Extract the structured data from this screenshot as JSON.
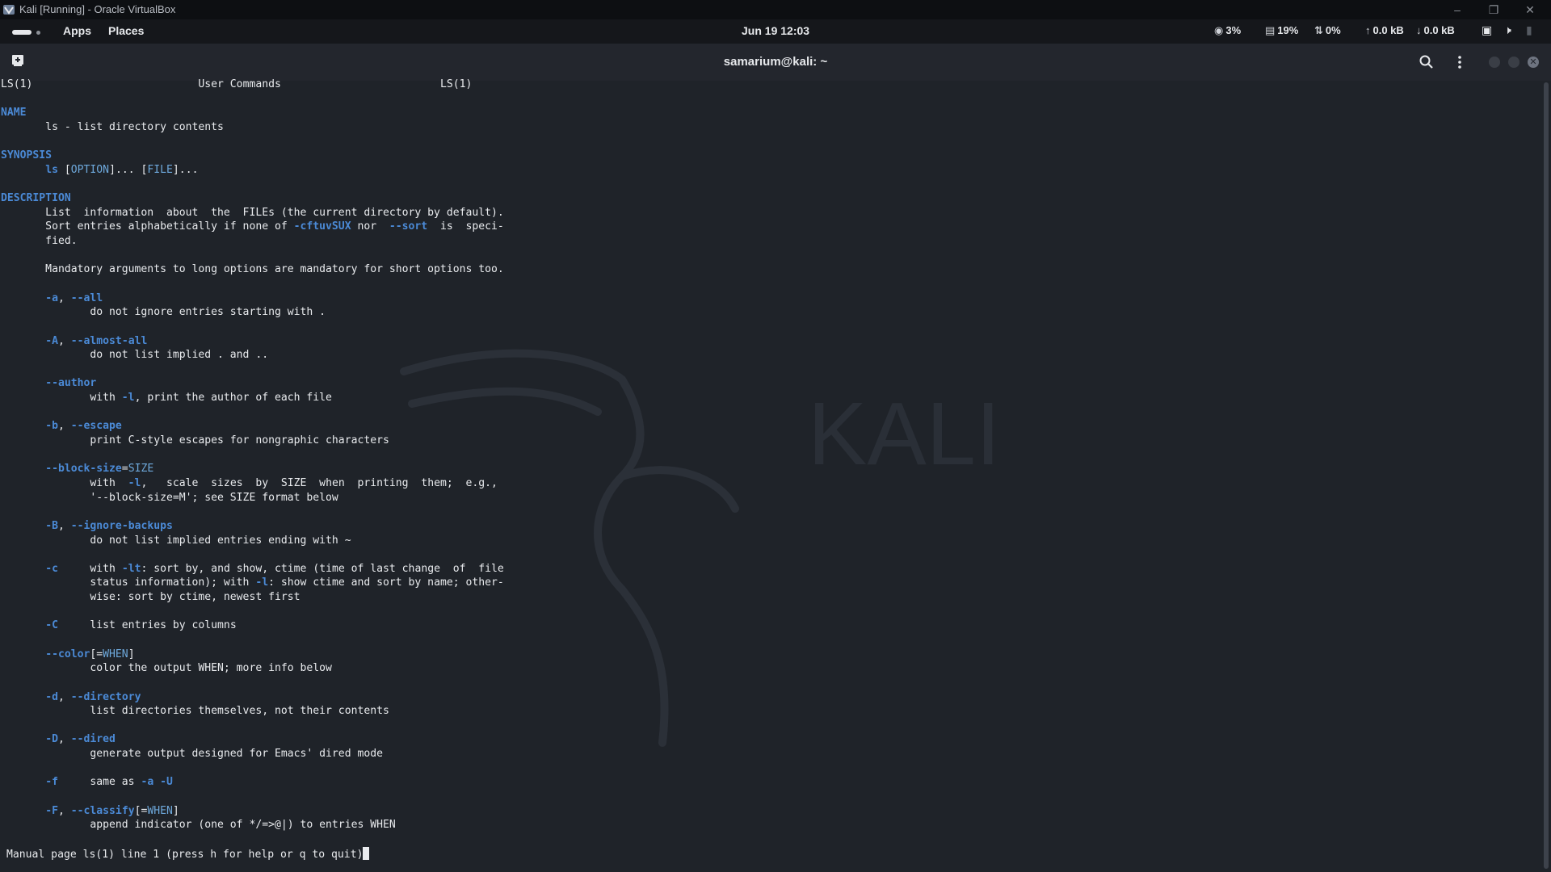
{
  "window": {
    "title": "Kali [Running] - Oracle VirtualBox",
    "icon": "virtualbox-icon",
    "controls": [
      "minimize-icon",
      "restore-icon",
      "close-icon"
    ]
  },
  "topbar": {
    "apps": "Apps",
    "places": "Places",
    "clock": "Jun 19  12:03",
    "stats": {
      "cpu": "3%",
      "mem": "19%",
      "swap": "0%",
      "net_up": "0.0 kB",
      "net_down": "0.0 kB"
    }
  },
  "terminal": {
    "title": "samarium@kali: ~",
    "watermark": "KALI",
    "status_line": "Manual page ls(1) line 1 (press h for help or q to quit)"
  },
  "man_lines": [
    [
      {
        "t": "LS(1)"
      },
      {
        "t": "                          User Commands                         "
      },
      {
        "t": "LS(1)"
      }
    ],
    [],
    [
      {
        "t": "NAME",
        "c": "b"
      }
    ],
    [
      {
        "t": "       ls - list directory contents"
      }
    ],
    [],
    [
      {
        "t": "SYNOPSIS",
        "c": "b"
      }
    ],
    [
      {
        "t": "       "
      },
      {
        "t": "ls",
        "c": "b"
      },
      {
        "t": " ["
      },
      {
        "t": "OPTION",
        "c": "u"
      },
      {
        "t": "]... ["
      },
      {
        "t": "FILE",
        "c": "u"
      },
      {
        "t": "]..."
      }
    ],
    [],
    [
      {
        "t": "DESCRIPTION",
        "c": "b"
      }
    ],
    [
      {
        "t": "       List  information  about  the  FILEs (the current directory by default)."
      }
    ],
    [
      {
        "t": "       Sort entries alphabetically if none of "
      },
      {
        "t": "-cftuvSUX",
        "c": "b"
      },
      {
        "t": " nor  "
      },
      {
        "t": "--sort",
        "c": "b"
      },
      {
        "t": "  is  speci‐"
      }
    ],
    [
      {
        "t": "       fied."
      }
    ],
    [],
    [
      {
        "t": "       Mandatory arguments to long options are mandatory for short options too."
      }
    ],
    [],
    [
      {
        "t": "       "
      },
      {
        "t": "-a",
        "c": "b"
      },
      {
        "t": ", "
      },
      {
        "t": "--all",
        "c": "b"
      }
    ],
    [
      {
        "t": "              do not ignore entries starting with ."
      }
    ],
    [],
    [
      {
        "t": "       "
      },
      {
        "t": "-A",
        "c": "b"
      },
      {
        "t": ", "
      },
      {
        "t": "--almost-all",
        "c": "b"
      }
    ],
    [
      {
        "t": "              do not list implied . and .."
      }
    ],
    [],
    [
      {
        "t": "       "
      },
      {
        "t": "--author",
        "c": "b"
      }
    ],
    [
      {
        "t": "              with "
      },
      {
        "t": "-l",
        "c": "b"
      },
      {
        "t": ", print the author of each file"
      }
    ],
    [],
    [
      {
        "t": "       "
      },
      {
        "t": "-b",
        "c": "b"
      },
      {
        "t": ", "
      },
      {
        "t": "--escape",
        "c": "b"
      }
    ],
    [
      {
        "t": "              print C-style escapes for nongraphic characters"
      }
    ],
    [],
    [
      {
        "t": "       "
      },
      {
        "t": "--block-size",
        "c": "b"
      },
      {
        "t": "="
      },
      {
        "t": "SIZE",
        "c": "u"
      }
    ],
    [
      {
        "t": "              with  "
      },
      {
        "t": "-l",
        "c": "b"
      },
      {
        "t": ",   scale  sizes  by  SIZE  when  printing  them;  e.g.,"
      }
    ],
    [
      {
        "t": "              '--block-size=M'; see SIZE format below"
      }
    ],
    [],
    [
      {
        "t": "       "
      },
      {
        "t": "-B",
        "c": "b"
      },
      {
        "t": ", "
      },
      {
        "t": "--ignore-backups",
        "c": "b"
      }
    ],
    [
      {
        "t": "              do not list implied entries ending with ~"
      }
    ],
    [],
    [
      {
        "t": "       "
      },
      {
        "t": "-c",
        "c": "b"
      },
      {
        "t": "     with "
      },
      {
        "t": "-lt",
        "c": "b"
      },
      {
        "t": ": sort by, and show, ctime (time of last change  of  file"
      }
    ],
    [
      {
        "t": "              status information); with "
      },
      {
        "t": "-l",
        "c": "b"
      },
      {
        "t": ": show ctime and sort by name; other‐"
      }
    ],
    [
      {
        "t": "              wise: sort by ctime, newest first"
      }
    ],
    [],
    [
      {
        "t": "       "
      },
      {
        "t": "-C",
        "c": "b"
      },
      {
        "t": "     list entries by columns"
      }
    ],
    [],
    [
      {
        "t": "       "
      },
      {
        "t": "--color",
        "c": "b"
      },
      {
        "t": "[="
      },
      {
        "t": "WHEN",
        "c": "u"
      },
      {
        "t": "]"
      }
    ],
    [
      {
        "t": "              color the output WHEN; more info below"
      }
    ],
    [],
    [
      {
        "t": "       "
      },
      {
        "t": "-d",
        "c": "b"
      },
      {
        "t": ", "
      },
      {
        "t": "--directory",
        "c": "b"
      }
    ],
    [
      {
        "t": "              list directories themselves, not their contents"
      }
    ],
    [],
    [
      {
        "t": "       "
      },
      {
        "t": "-D",
        "c": "b"
      },
      {
        "t": ", "
      },
      {
        "t": "--dired",
        "c": "b"
      }
    ],
    [
      {
        "t": "              generate output designed for Emacs' dired mode"
      }
    ],
    [],
    [
      {
        "t": "       "
      },
      {
        "t": "-f",
        "c": "b"
      },
      {
        "t": "     same as "
      },
      {
        "t": "-a",
        "c": "b"
      },
      {
        "t": " "
      },
      {
        "t": "-U",
        "c": "b"
      }
    ],
    [],
    [
      {
        "t": "       "
      },
      {
        "t": "-F",
        "c": "b"
      },
      {
        "t": ", "
      },
      {
        "t": "--classify",
        "c": "b"
      },
      {
        "t": "[="
      },
      {
        "t": "WHEN",
        "c": "u"
      },
      {
        "t": "]"
      }
    ],
    [
      {
        "t": "              append indicator (one of */=>@|) to entries WHEN"
      }
    ]
  ]
}
